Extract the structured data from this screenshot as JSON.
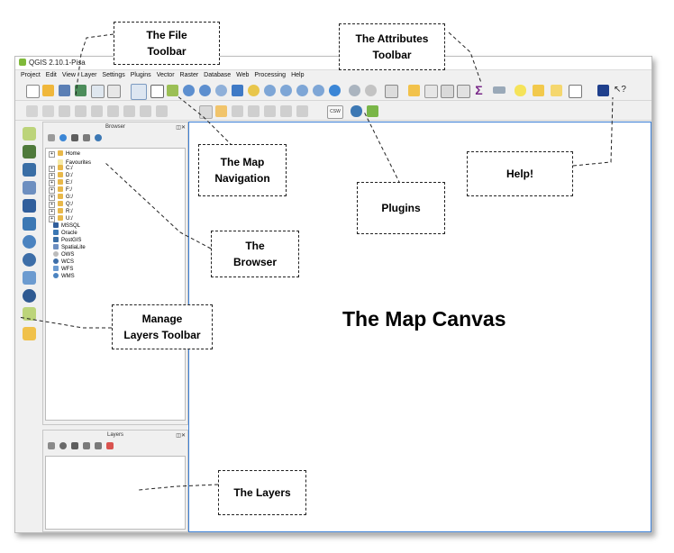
{
  "window": {
    "title": "QGIS 2.10.1-Pisa"
  },
  "menu": [
    "Project",
    "Edit",
    "View",
    "Layer",
    "Settings",
    "Plugins",
    "Vector",
    "Raster",
    "Database",
    "Web",
    "Processing",
    "Help"
  ],
  "browser": {
    "title": "Browser",
    "items": [
      "Home",
      "Favourites",
      "C:/",
      "D:/",
      "E:/",
      "F:/",
      "G:/",
      "Q:/",
      "R:/",
      "U:/",
      "MSSQL",
      "Oracle",
      "PostGIS",
      "SpatiaLite",
      "OWS",
      "WCS",
      "WFS",
      "WMS"
    ]
  },
  "layers_panel": {
    "title": "Layers"
  },
  "toolbar": {
    "csw_label": "CSW"
  },
  "canvas": {
    "label": "The Map Canvas"
  },
  "callouts": {
    "file_toolbar": "The File\nToolbar",
    "attributes_toolbar": "The Attributes\nToolbar",
    "map_navigation": "The Map\nNavigation",
    "help": "Help!",
    "plugins": "Plugins",
    "browser": "The\nBrowser",
    "manage_layers": "Manage\nLayers Toolbar",
    "layers": "The Layers"
  },
  "colors": {
    "canvas_border": "#3b7fd6",
    "folder": "#e8b84a",
    "qgis_green": "#7fb93a"
  }
}
